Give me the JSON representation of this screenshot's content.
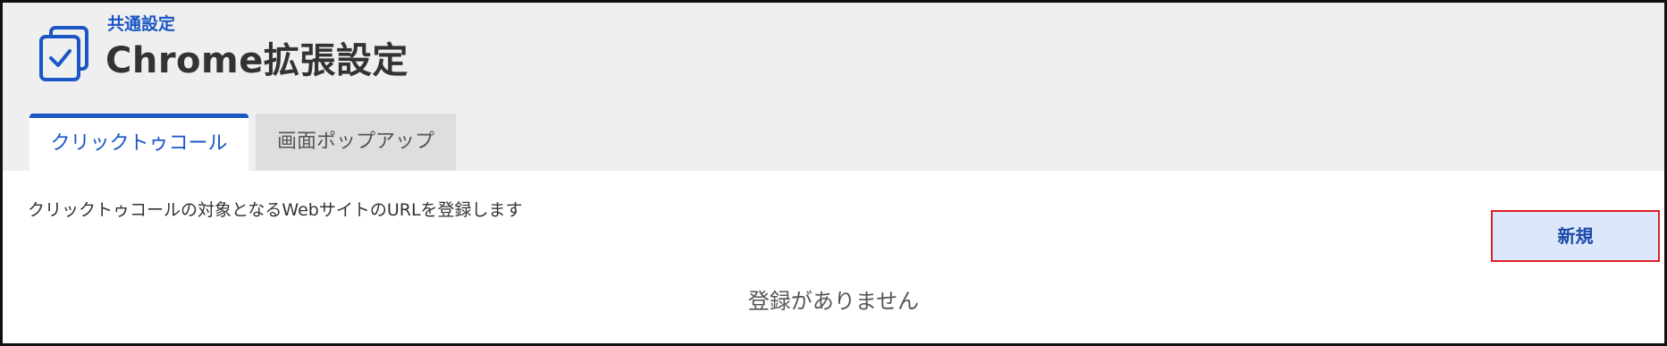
{
  "header": {
    "breadcrumb": "共通設定",
    "title": "Chrome拡張設定",
    "icon": "checkbox-stack-icon"
  },
  "tabs": [
    {
      "label": "クリックトゥコール",
      "active": true
    },
    {
      "label": "画面ポップアップ",
      "active": false
    }
  ],
  "main": {
    "description": "クリックトゥコールの対象となるWebサイトのURLを登録します",
    "new_button_label": "新規",
    "empty_message": "登録がありません"
  },
  "colors": {
    "accent": "#1a56c4",
    "header_bg": "#efefef",
    "button_bg": "#dde7fb",
    "highlight_border": "#e02020"
  }
}
